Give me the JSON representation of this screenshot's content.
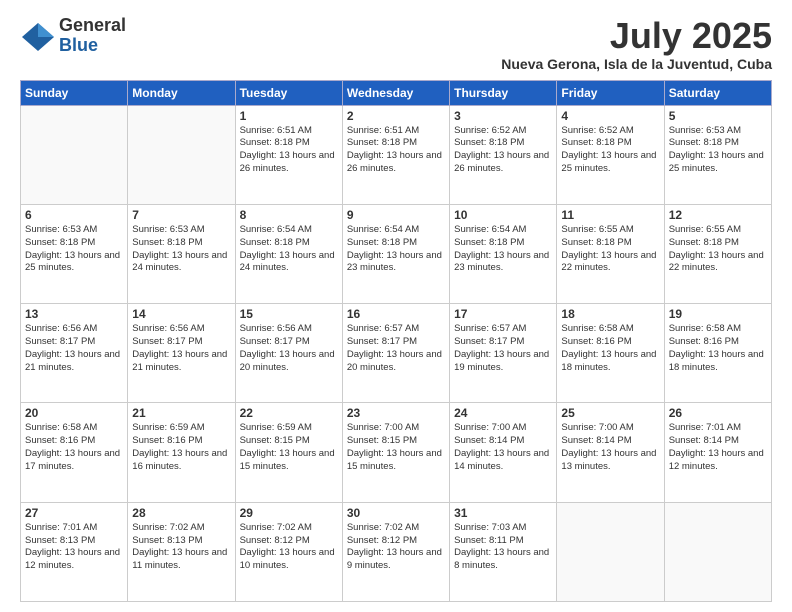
{
  "header": {
    "logo_general": "General",
    "logo_blue": "Blue",
    "month_title": "July 2025",
    "location": "Nueva Gerona, Isla de la Juventud, Cuba"
  },
  "days_of_week": [
    "Sunday",
    "Monday",
    "Tuesday",
    "Wednesday",
    "Thursday",
    "Friday",
    "Saturday"
  ],
  "weeks": [
    [
      {
        "day": "",
        "info": ""
      },
      {
        "day": "",
        "info": ""
      },
      {
        "day": "1",
        "info": "Sunrise: 6:51 AM\nSunset: 8:18 PM\nDaylight: 13 hours and 26 minutes."
      },
      {
        "day": "2",
        "info": "Sunrise: 6:51 AM\nSunset: 8:18 PM\nDaylight: 13 hours and 26 minutes."
      },
      {
        "day": "3",
        "info": "Sunrise: 6:52 AM\nSunset: 8:18 PM\nDaylight: 13 hours and 26 minutes."
      },
      {
        "day": "4",
        "info": "Sunrise: 6:52 AM\nSunset: 8:18 PM\nDaylight: 13 hours and 25 minutes."
      },
      {
        "day": "5",
        "info": "Sunrise: 6:53 AM\nSunset: 8:18 PM\nDaylight: 13 hours and 25 minutes."
      }
    ],
    [
      {
        "day": "6",
        "info": "Sunrise: 6:53 AM\nSunset: 8:18 PM\nDaylight: 13 hours and 25 minutes."
      },
      {
        "day": "7",
        "info": "Sunrise: 6:53 AM\nSunset: 8:18 PM\nDaylight: 13 hours and 24 minutes."
      },
      {
        "day": "8",
        "info": "Sunrise: 6:54 AM\nSunset: 8:18 PM\nDaylight: 13 hours and 24 minutes."
      },
      {
        "day": "9",
        "info": "Sunrise: 6:54 AM\nSunset: 8:18 PM\nDaylight: 13 hours and 23 minutes."
      },
      {
        "day": "10",
        "info": "Sunrise: 6:54 AM\nSunset: 8:18 PM\nDaylight: 13 hours and 23 minutes."
      },
      {
        "day": "11",
        "info": "Sunrise: 6:55 AM\nSunset: 8:18 PM\nDaylight: 13 hours and 22 minutes."
      },
      {
        "day": "12",
        "info": "Sunrise: 6:55 AM\nSunset: 8:18 PM\nDaylight: 13 hours and 22 minutes."
      }
    ],
    [
      {
        "day": "13",
        "info": "Sunrise: 6:56 AM\nSunset: 8:17 PM\nDaylight: 13 hours and 21 minutes."
      },
      {
        "day": "14",
        "info": "Sunrise: 6:56 AM\nSunset: 8:17 PM\nDaylight: 13 hours and 21 minutes."
      },
      {
        "day": "15",
        "info": "Sunrise: 6:56 AM\nSunset: 8:17 PM\nDaylight: 13 hours and 20 minutes."
      },
      {
        "day": "16",
        "info": "Sunrise: 6:57 AM\nSunset: 8:17 PM\nDaylight: 13 hours and 20 minutes."
      },
      {
        "day": "17",
        "info": "Sunrise: 6:57 AM\nSunset: 8:17 PM\nDaylight: 13 hours and 19 minutes."
      },
      {
        "day": "18",
        "info": "Sunrise: 6:58 AM\nSunset: 8:16 PM\nDaylight: 13 hours and 18 minutes."
      },
      {
        "day": "19",
        "info": "Sunrise: 6:58 AM\nSunset: 8:16 PM\nDaylight: 13 hours and 18 minutes."
      }
    ],
    [
      {
        "day": "20",
        "info": "Sunrise: 6:58 AM\nSunset: 8:16 PM\nDaylight: 13 hours and 17 minutes."
      },
      {
        "day": "21",
        "info": "Sunrise: 6:59 AM\nSunset: 8:16 PM\nDaylight: 13 hours and 16 minutes."
      },
      {
        "day": "22",
        "info": "Sunrise: 6:59 AM\nSunset: 8:15 PM\nDaylight: 13 hours and 15 minutes."
      },
      {
        "day": "23",
        "info": "Sunrise: 7:00 AM\nSunset: 8:15 PM\nDaylight: 13 hours and 15 minutes."
      },
      {
        "day": "24",
        "info": "Sunrise: 7:00 AM\nSunset: 8:14 PM\nDaylight: 13 hours and 14 minutes."
      },
      {
        "day": "25",
        "info": "Sunrise: 7:00 AM\nSunset: 8:14 PM\nDaylight: 13 hours and 13 minutes."
      },
      {
        "day": "26",
        "info": "Sunrise: 7:01 AM\nSunset: 8:14 PM\nDaylight: 13 hours and 12 minutes."
      }
    ],
    [
      {
        "day": "27",
        "info": "Sunrise: 7:01 AM\nSunset: 8:13 PM\nDaylight: 13 hours and 12 minutes."
      },
      {
        "day": "28",
        "info": "Sunrise: 7:02 AM\nSunset: 8:13 PM\nDaylight: 13 hours and 11 minutes."
      },
      {
        "day": "29",
        "info": "Sunrise: 7:02 AM\nSunset: 8:12 PM\nDaylight: 13 hours and 10 minutes."
      },
      {
        "day": "30",
        "info": "Sunrise: 7:02 AM\nSunset: 8:12 PM\nDaylight: 13 hours and 9 minutes."
      },
      {
        "day": "31",
        "info": "Sunrise: 7:03 AM\nSunset: 8:11 PM\nDaylight: 13 hours and 8 minutes."
      },
      {
        "day": "",
        "info": ""
      },
      {
        "day": "",
        "info": ""
      }
    ]
  ]
}
